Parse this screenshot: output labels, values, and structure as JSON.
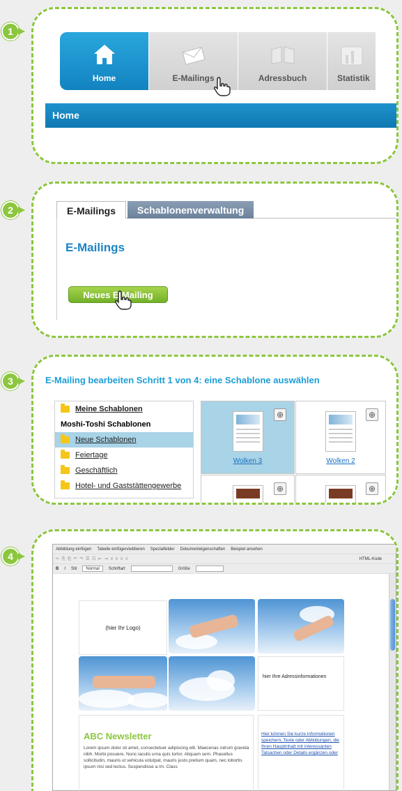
{
  "steps": [
    "1",
    "2",
    "3",
    "4"
  ],
  "nav": {
    "tabs": [
      {
        "label": "Home",
        "icon": "home-icon",
        "active": true
      },
      {
        "label": "E-Mailings",
        "icon": "envelope-icon",
        "active": false
      },
      {
        "label": "Adressbuch",
        "icon": "book-icon",
        "active": false
      },
      {
        "label": "Statistik",
        "icon": "chart-icon",
        "active": false
      }
    ],
    "page_title": "Home"
  },
  "emailings": {
    "tabs": [
      "E-Mailings",
      "Schablonenverwaltung"
    ],
    "title": "E-Mailings",
    "new_button": "Neues E-Mailing"
  },
  "templates": {
    "step_title": "E-Mailing bearbeiten Schritt 1 von 4: eine Schablone auswählen",
    "my_templates": "Meine Schablonen",
    "group_title": "Moshi-Toshi Schablonen",
    "folders": [
      "Neue Schablonen",
      "Feiertage",
      "Geschäftlich",
      "Hotel- und Gaststättengewerbe"
    ],
    "items": [
      "Wolken 3",
      "Wolken 2"
    ]
  },
  "editor": {
    "toolbar1": [
      "Abbildung einfügen",
      "Tabelle einfügen/editieren",
      "Spezialfelder",
      "Dokumenteigenschaften",
      "Beispiel ansehen"
    ],
    "toolbar2_right": "HTML-Kode",
    "style_label": "Stil",
    "style_value": "Normal",
    "font_label": "Schriftart",
    "size_label": "Größe",
    "logo_placeholder": "(hier Ihr Logo)",
    "address_placeholder": "hier Ihre Adressinformationen",
    "newsletter_title": "ABC Newsletter",
    "newsletter_text": "Lorem ipsum dolor sit amet, consectetuer adipiscing elit. Maecenas rutrum gravida nibh. Morbi posuere. Nunc iaculis urna quis tortor. Aliquam sem. Phasellus sollicitudin, mauris ut vehicula volutpat, mauris justo pretium quam, nec lobortis ipsum nisi sed lectus. Suspendisse a mi. Class",
    "side_text": "Hier können Sie kurze Informationen speichern, Texte oder Abbildungen, die Ihren Hauptinhalt mit interessanten Tatsachen oder Details ergänzen oder"
  },
  "colors": {
    "accent_green": "#8cc63f",
    "accent_blue": "#1c84c3"
  }
}
